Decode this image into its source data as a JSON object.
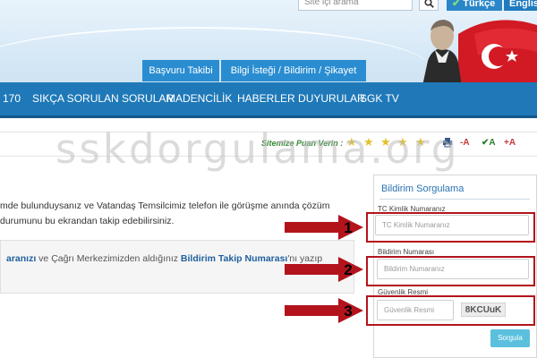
{
  "header": {
    "search_placeholder": "Site içi arama",
    "lang_tr": "Türkçe",
    "lang_en": "English",
    "tabs": [
      {
        "label": "Başvuru Takibi"
      },
      {
        "label": "Bilgi İsteği / Bildirim / Şikayet"
      }
    ]
  },
  "nav": {
    "items": [
      {
        "label": "170"
      },
      {
        "label": "SIKÇA SORULAN SORULAR"
      },
      {
        "label": "MADENCİLİK"
      },
      {
        "label": "HABERLER DUYURULAR"
      },
      {
        "label": "SGK TV"
      }
    ]
  },
  "toolbar": {
    "rate_label": "Sitemize Puan Verin :",
    "stars": 5,
    "font_decrease": "-A",
    "font_normal": "A",
    "font_increase": "+A"
  },
  "watermark": "sskdorgulama.org",
  "content": {
    "line1": "mde bulunduysanız ve Vatandaş Temsilcimiz telefon ile görüşme anında çözüm",
    "line2": "durumunu bu ekrandan takip edebilirsiniz.",
    "info_part1": "aranızı",
    "info_part2": " ve Çağrı Merkezimizden aldığınız ",
    "info_part3": "Bildirim Takip Numarası",
    "info_part4": "'nı yazıp"
  },
  "panel": {
    "title": "Bildirim Sorgulama",
    "tc_label": "TC Kimlik Numaranız",
    "tc_placeholder": "TC Kimlik Numaranız",
    "bildirim_label": "Bildirim Numarası",
    "bildirim_placeholder": "Bildirim Numaranız",
    "security_label": "Güvenlik Resmi",
    "security_placeholder": "Güvenlik Resmi",
    "captcha": "8KCUuK",
    "submit": "Sorgula"
  },
  "annotations": [
    "1",
    "2",
    "3"
  ],
  "colors": {
    "nav_blue": "#1f79b8",
    "tab_blue": "#2a8dd1",
    "annotation_red": "#b3141c",
    "button": "#5bc0de"
  }
}
